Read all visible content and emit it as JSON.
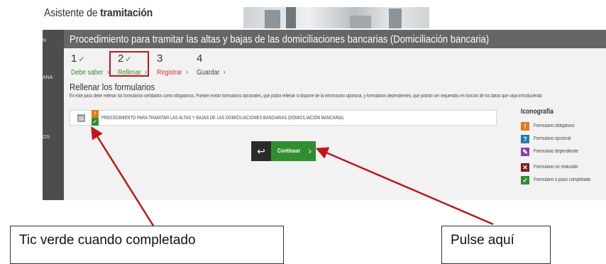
{
  "header": {
    "title_prefix": "Asistente de ",
    "title_bold": "tramitación"
  },
  "sidebar": {
    "items": [
      {
        "label": "N"
      },
      {
        "label": "ANA"
      },
      {
        "label": "OS"
      }
    ]
  },
  "banner": {
    "title": "Procedimiento para tramitar las altas y bajas de las domiciliaciones bancarias (Domiciliación bancaria)"
  },
  "steps": [
    {
      "number": "1",
      "label": "Debe saber",
      "completed": true
    },
    {
      "number": "2",
      "label": "Rellenar",
      "completed": true,
      "current": true
    },
    {
      "number": "3",
      "label": "Registrar",
      "completed": false
    },
    {
      "number": "4",
      "label": "Guardar",
      "completed": false
    }
  ],
  "section": {
    "title": "Rellenar los formularios",
    "instructions": "En este paso debe rellenar los formularios señalados como obligatorios. Pueden existir formularios opcionales, que podrá rellenar si dispone de la información oportuna, y formularios dependientes, que podrán ser requeridos en función de los datos que vaya introduciendo"
  },
  "form": {
    "name": "PROCEDIMIENTO PARA TRAMITAR LAS ALTAS Y BAJAS DE LAS DOMICILIACIONES BANCARIAS (DOMICILIACIÓN BANCARIA)"
  },
  "legend": {
    "title": "Iconografía",
    "items": [
      {
        "label": "Formulario obligatorio",
        "color": "#e07a1f",
        "glyph": "!"
      },
      {
        "label": "Formulario opcional",
        "color": "#1f7fa8",
        "glyph": "?"
      },
      {
        "label": "Formulario dependiente",
        "color": "#8e3fa8",
        "glyph": "✎"
      },
      {
        "label": "Formulario no realizado",
        "color": "#7a1f1f",
        "glyph": "✕"
      },
      {
        "label": "Formulario o paso completado",
        "color": "#2f8f2f",
        "glyph": "✓"
      }
    ]
  },
  "buttons": {
    "back_glyph": "↩",
    "continue_label": "Continuar",
    "continue_chevron": "›"
  },
  "callouts": {
    "left": "Tic verde cuando completado",
    "right": "Pulse aquí"
  },
  "colors": {
    "accent_green": "#2f8f2f",
    "highlight_red": "#c0161b",
    "banner_gray": "#666666"
  }
}
